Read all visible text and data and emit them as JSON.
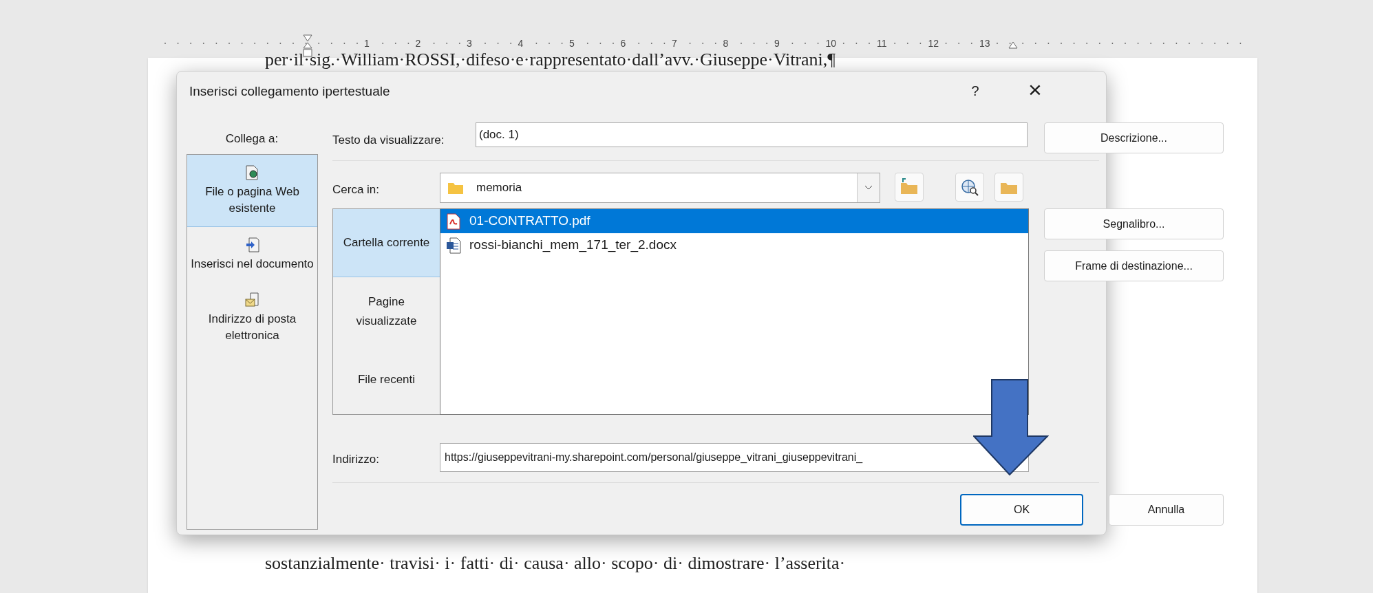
{
  "ruler": {
    "numbers": [
      "1",
      "2",
      "3",
      "4",
      "5",
      "6",
      "7",
      "8",
      "9",
      "10",
      "11",
      "12",
      "13"
    ]
  },
  "document": {
    "lines": [
      "per·il·sig.·William·ROSSI,·difeso·e·rappresentato·dall’avv.·Giuseppe·Vitrani,¶",
      "sostanzialmente· travisi· i· fatti· di· causa· allo· scopo· di· dimostrare· l’asserita·"
    ]
  },
  "dialog": {
    "title": "Inserisci collegamento ipertestuale",
    "help": "?",
    "close": "×",
    "link_to": {
      "label": "Collega a:",
      "items": [
        {
          "kind": "file",
          "label": "File o pagina Web esistente",
          "selected": true
        },
        {
          "kind": "place",
          "label": "Inserisci nel documento",
          "selected": false
        },
        {
          "kind": "email",
          "label": "Indirizzo di posta elettronica",
          "selected": false
        }
      ]
    },
    "display_text": {
      "label": "Testo da visualizzare:",
      "value": "(doc. 1)"
    },
    "look_in": {
      "label": "Cerca in:",
      "value": "memoria"
    },
    "nav": [
      {
        "label": "Cartella corrente",
        "selected": true
      },
      {
        "label": "Pagine visualizzate",
        "selected": false
      },
      {
        "label": "File recenti",
        "selected": false
      }
    ],
    "files": [
      {
        "kind": "pdf",
        "name": "01-CONTRATTO.pdf",
        "selected": true
      },
      {
        "kind": "word",
        "name": "rossi-bianchi_mem_171_ter_2.docx",
        "selected": false
      }
    ],
    "address": {
      "label": "Indirizzo:",
      "value": "https://giuseppevitrani-my.sharepoint.com/personal/giuseppe_vitrani_giuseppevitrani_"
    },
    "side_buttons": [
      "Descrizione...",
      "Segnalibro...",
      "Frame di destinazione..."
    ],
    "ok": "OK",
    "cancel": "Annulla"
  }
}
